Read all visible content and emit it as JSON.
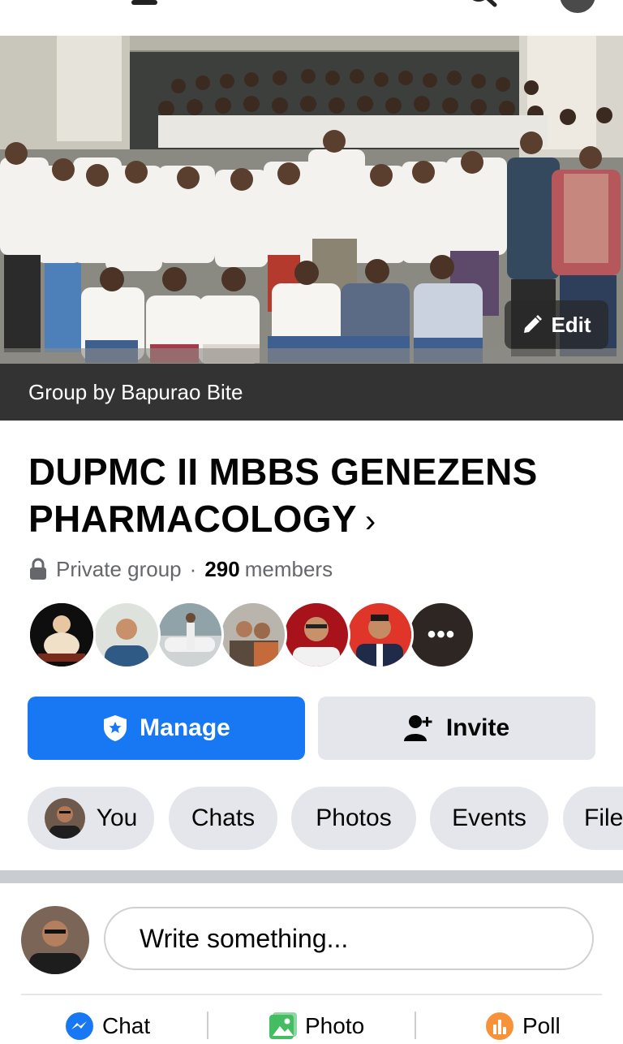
{
  "cover": {
    "edit_label": "Edit",
    "group_by": "Group by Bapurao Bite"
  },
  "group": {
    "name": "DUPMC II MBBS GENEZENS PHARMACOLOGY",
    "chevron": "›",
    "privacy": "Private group",
    "separator": "·",
    "member_count": "290",
    "members_label": "members",
    "more_members": "•••"
  },
  "buttons": {
    "manage": "Manage",
    "invite": "Invite"
  },
  "tabs": [
    {
      "label": "You"
    },
    {
      "label": "Chats"
    },
    {
      "label": "Photos"
    },
    {
      "label": "Events"
    },
    {
      "label": "Files"
    }
  ],
  "composer": {
    "placeholder": "Write something..."
  },
  "actions": [
    {
      "label": "Chat",
      "icon": "messenger-icon"
    },
    {
      "label": "Photo",
      "icon": "photo-icon"
    },
    {
      "label": "Poll",
      "icon": "poll-icon"
    }
  ],
  "colors": {
    "primary": "#1877f2",
    "secondary_bg": "#e4e6eb",
    "group_by_bar": "#333333",
    "photo_green": "#45bd62",
    "poll_orange": "#f7923b"
  }
}
